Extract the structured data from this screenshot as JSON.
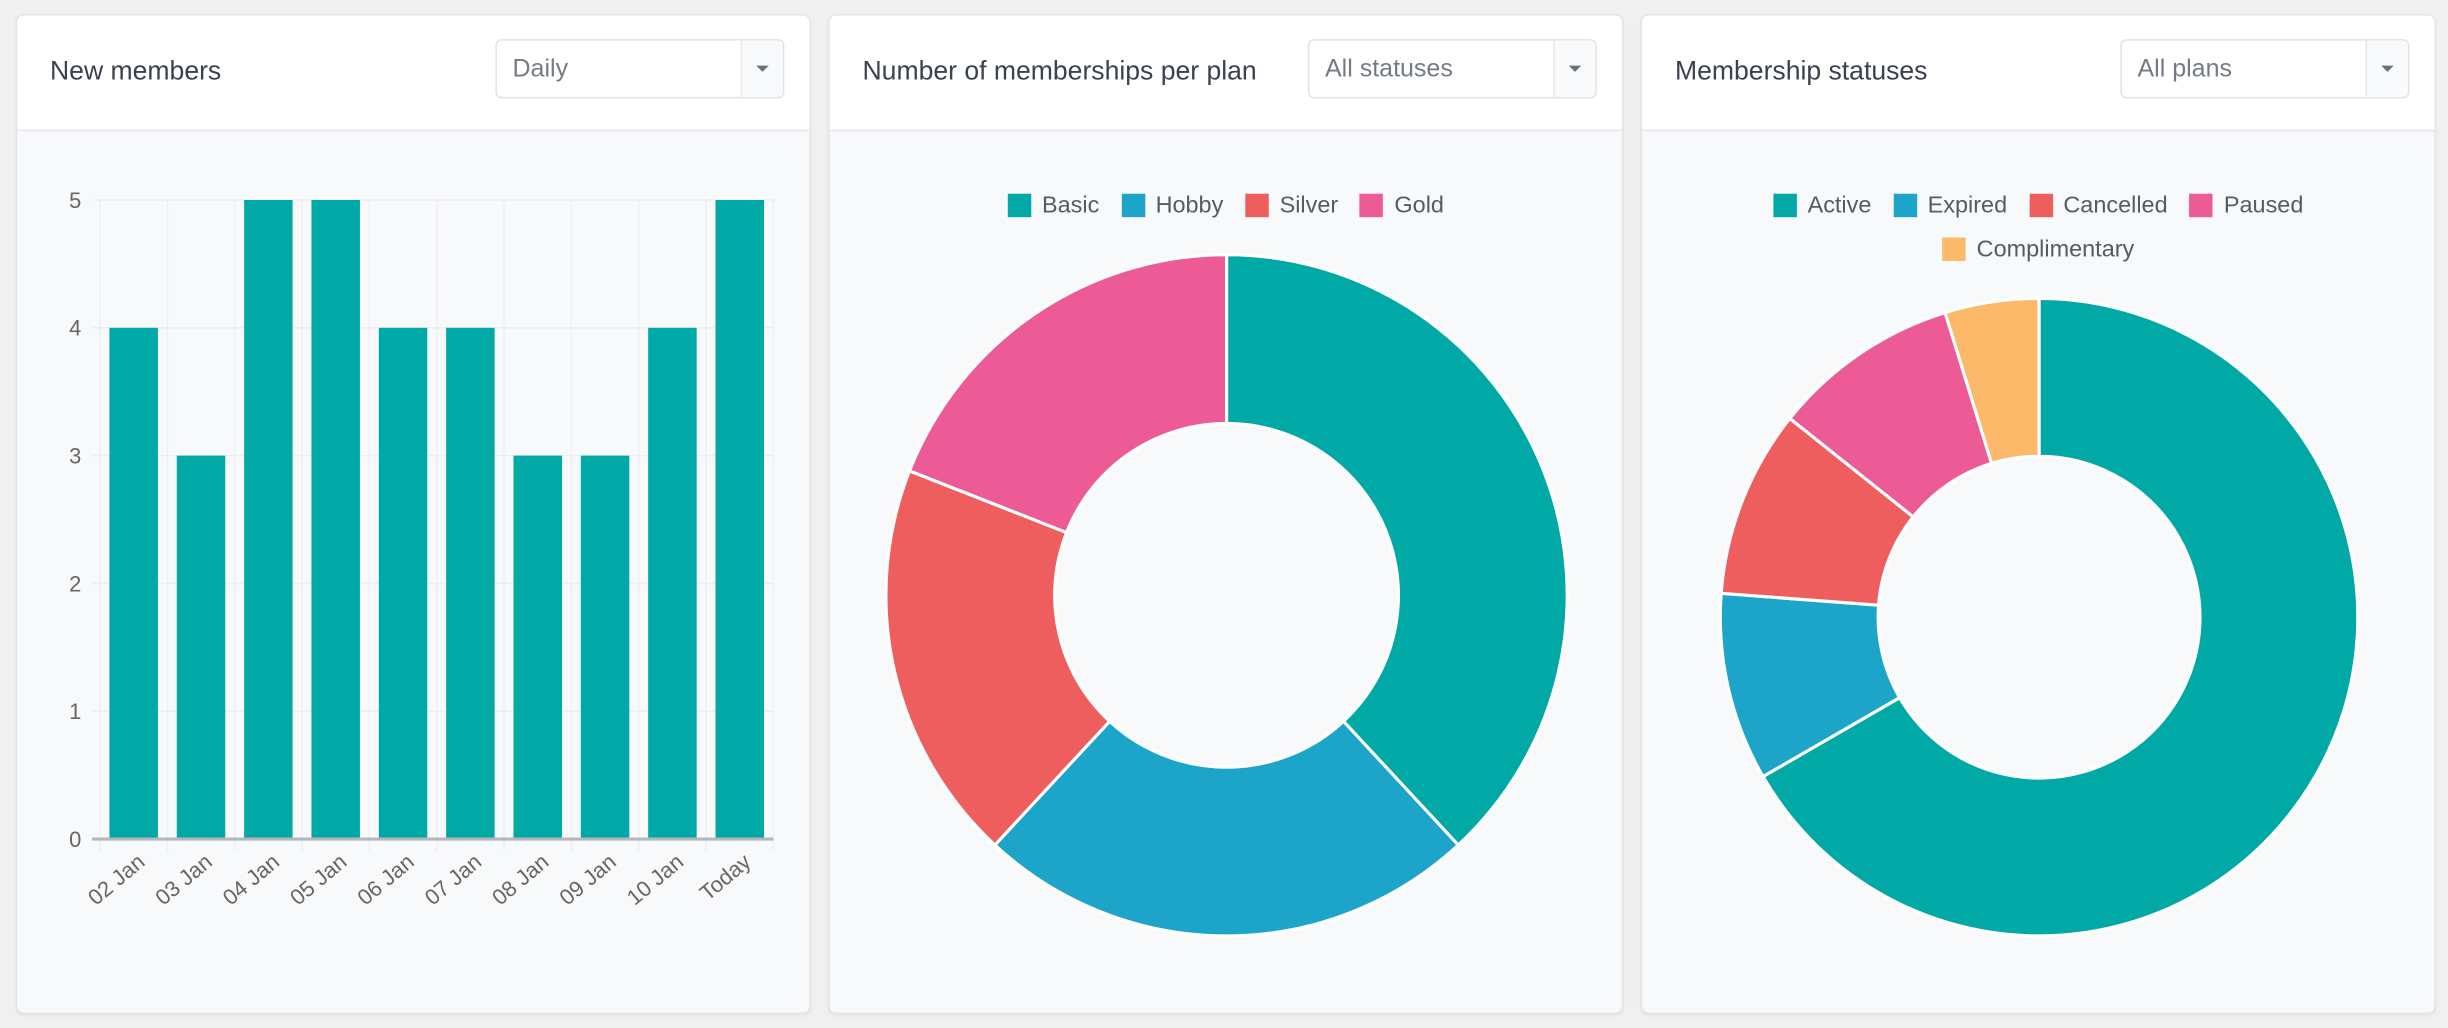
{
  "panels": [
    {
      "title": "New members",
      "filter": {
        "value": "Daily"
      },
      "chart_data": {
        "type": "bar",
        "title": "New members",
        "xlabel": "",
        "ylabel": "",
        "categories": [
          "02 Jan",
          "03 Jan",
          "04 Jan",
          "05 Jan",
          "06 Jan",
          "07 Jan",
          "08 Jan",
          "09 Jan",
          "10 Jan",
          "Today"
        ],
        "values": [
          4,
          3,
          5,
          5,
          4,
          4,
          3,
          3,
          4,
          5
        ],
        "ylim": [
          0,
          5
        ],
        "yticks": [
          "0",
          "1",
          "2",
          "3",
          "4",
          "5"
        ],
        "grid": true,
        "color": "#00a9a6"
      }
    },
    {
      "title": "Number of memberships per plan",
      "filter": {
        "value": "All statuses"
      },
      "chart_data": {
        "type": "pie",
        "donut": true,
        "title": "Number of memberships per plan",
        "legend_position": "top",
        "labels": [
          "Basic",
          "Hobby",
          "Silver",
          "Gold"
        ],
        "values": [
          8,
          5,
          4,
          4
        ],
        "colors": [
          "#00a9a6",
          "#1ca5c9",
          "#ef5e5e",
          "#ec5b95"
        ]
      }
    },
    {
      "title": "Membership statuses",
      "filter": {
        "value": "All plans"
      },
      "chart_data": {
        "type": "pie",
        "donut": true,
        "title": "Membership statuses",
        "legend_position": "top",
        "labels": [
          "Active",
          "Expired",
          "Cancelled",
          "Paused",
          "Complimentary"
        ],
        "values": [
          14,
          2,
          2,
          2,
          1
        ],
        "colors": [
          "#00a9a6",
          "#1ca5c9",
          "#ef5e5e",
          "#ec5b95",
          "#fbb969"
        ]
      }
    }
  ]
}
